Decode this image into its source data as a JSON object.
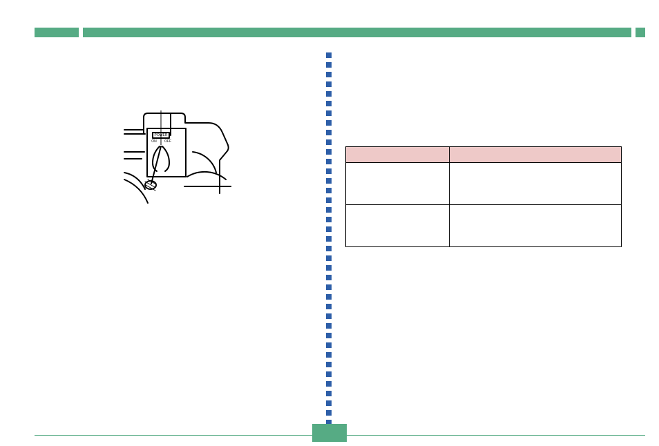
{
  "header": {
    "title": ""
  },
  "left": {
    "caption": "",
    "illustration": {
      "alt": "power-switch-panel-illustration",
      "labels": {
        "power": "POWER",
        "on": "ON",
        "off": "OFF"
      }
    }
  },
  "right": {
    "heading": "",
    "table": {
      "headers": [
        "",
        ""
      ],
      "rows": [
        [
          "",
          ""
        ],
        [
          "",
          ""
        ]
      ]
    }
  },
  "footer": {
    "page": ""
  }
}
